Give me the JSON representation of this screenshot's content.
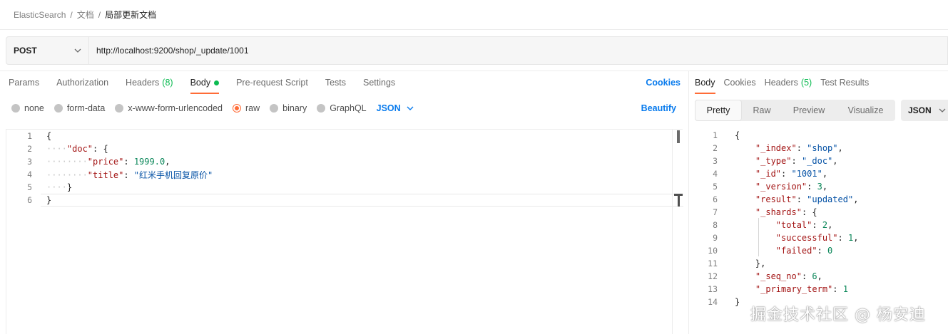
{
  "breadcrumb": [
    "ElasticSearch",
    "文档",
    "局部更新文档"
  ],
  "breadcrumb_sep": "/",
  "request": {
    "method": "POST",
    "url": "http://localhost:9200/shop/_update/1001"
  },
  "request_tabs": {
    "params": "Params",
    "authorization": "Authorization",
    "headers": "Headers",
    "headers_count": "(8)",
    "body": "Body",
    "prerequest": "Pre-request Script",
    "tests": "Tests",
    "settings": "Settings",
    "cookies": "Cookies"
  },
  "body_options": {
    "none": "none",
    "form_data": "form-data",
    "urlencoded": "x-www-form-urlencoded",
    "raw": "raw",
    "binary": "binary",
    "graphql": "GraphQL",
    "language": "JSON",
    "beautify": "Beautify"
  },
  "request_body": {
    "line_numbers": [
      "1",
      "2",
      "3",
      "4",
      "5",
      "6"
    ],
    "doc_key": "\"doc\"",
    "price_key": "\"price\"",
    "price_value": "1999.0",
    "title_key": "\"title\"",
    "title_value": "\"红米手机回复原价\""
  },
  "response_tabs": {
    "body": "Body",
    "cookies": "Cookies",
    "headers": "Headers",
    "headers_count": "(5)",
    "test_results": "Test Results"
  },
  "response_view": {
    "pretty": "Pretty",
    "raw": "Raw",
    "preview": "Preview",
    "visualize": "Visualize",
    "language": "JSON"
  },
  "response_body": {
    "line_numbers": [
      "1",
      "2",
      "3",
      "4",
      "5",
      "6",
      "7",
      "8",
      "9",
      "10",
      "11",
      "12",
      "13",
      "14"
    ],
    "index_key": "\"_index\"",
    "index_val": "\"shop\"",
    "type_key": "\"_type\"",
    "type_val": "\"_doc\"",
    "id_key": "\"_id\"",
    "id_val": "\"1001\"",
    "version_key": "\"_version\"",
    "version_val": "3",
    "result_key": "\"result\"",
    "result_val": "\"updated\"",
    "shards_key": "\"_shards\"",
    "total_key": "\"total\"",
    "total_val": "2",
    "successful_key": "\"successful\"",
    "successful_val": "1",
    "failed_key": "\"failed\"",
    "failed_val": "0",
    "seq_key": "\"_seq_no\"",
    "seq_val": "6",
    "primary_key": "\"_primary_term\"",
    "primary_val": "1"
  },
  "watermark": "掘金技术社区 @ 杨安迪",
  "colors": {
    "accent": "#ff6c37",
    "link": "#097bed",
    "success": "#0cbb52",
    "json_key": "#a31515",
    "json_string": "#0451a5",
    "json_number": "#098658"
  },
  "icons": {
    "method_dropdown": "chevron-down-icon",
    "language_dropdown": "chevron-down-icon",
    "body_status": "green-dot-icon"
  }
}
